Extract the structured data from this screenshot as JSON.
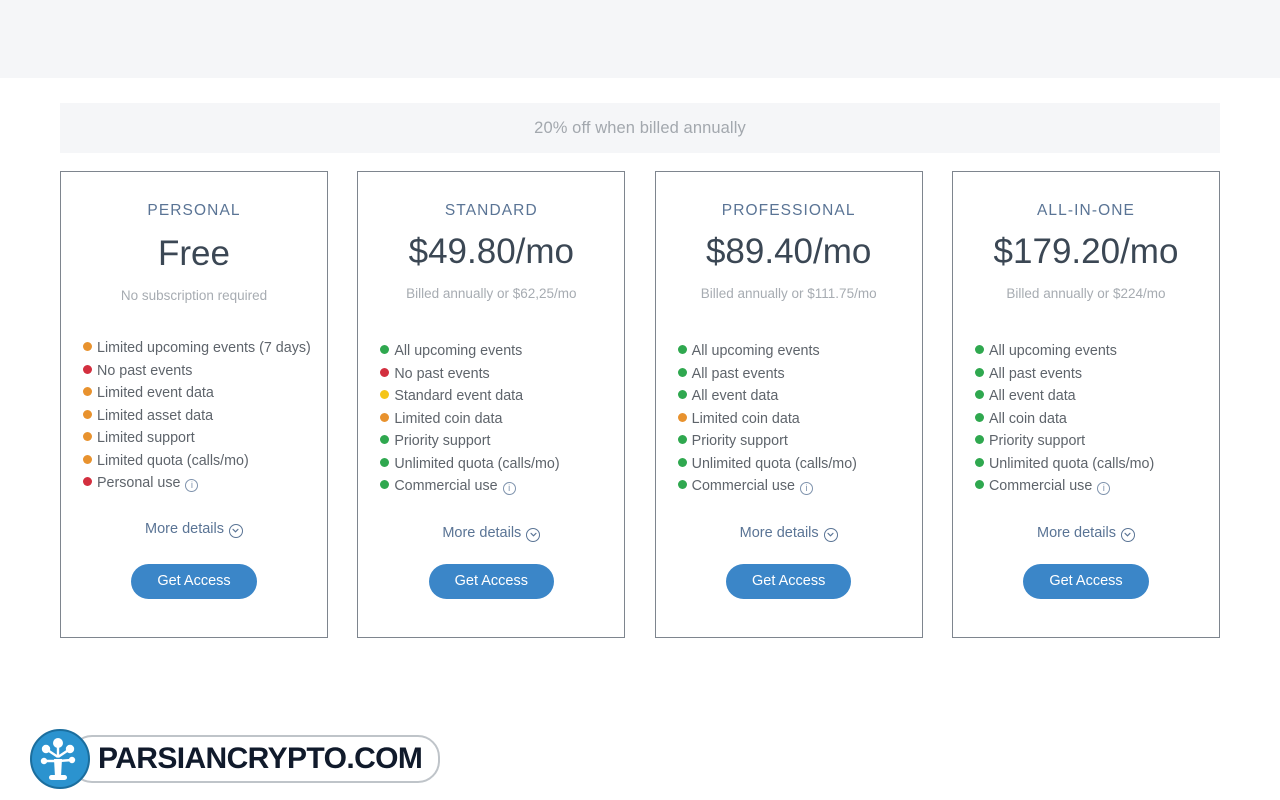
{
  "banner": {
    "text": "20% off when billed annually"
  },
  "colors": {
    "accent_blue": "#3b86c8",
    "title_blue": "#5a7495",
    "green": "#2fa84f",
    "red": "#d32f3f",
    "orange": "#e8922e",
    "yellow": "#f5c518"
  },
  "common": {
    "more_details_label": "More details",
    "cta_label": "Get Access",
    "info_glyph": "i",
    "chevron_icon": "chevron-down-icon"
  },
  "plans": [
    {
      "name": "PERSONAL",
      "price": "Free",
      "billing_note": "No subscription required",
      "features": [
        {
          "label": "Limited upcoming events (7 days)",
          "color": "#e8922e",
          "info": false
        },
        {
          "label": "No past events",
          "color": "#d32f3f",
          "info": false
        },
        {
          "label": "Limited event data",
          "color": "#e8922e",
          "info": false
        },
        {
          "label": "Limited asset data",
          "color": "#e8922e",
          "info": false
        },
        {
          "label": "Limited support",
          "color": "#e8922e",
          "info": false
        },
        {
          "label": "Limited quota (calls/mo)",
          "color": "#e8922e",
          "info": false
        },
        {
          "label": "Personal use",
          "color": "#d32f3f",
          "info": true
        }
      ]
    },
    {
      "name": "STANDARD",
      "price": "$49.80/mo",
      "billing_note": "Billed annually or $62,25/mo",
      "features": [
        {
          "label": "All upcoming events",
          "color": "#2fa84f",
          "info": false
        },
        {
          "label": "No past events",
          "color": "#d32f3f",
          "info": false
        },
        {
          "label": "Standard event data",
          "color": "#f5c518",
          "info": false
        },
        {
          "label": "Limited coin data",
          "color": "#e8922e",
          "info": false
        },
        {
          "label": "Priority support",
          "color": "#2fa84f",
          "info": false
        },
        {
          "label": "Unlimited quota (calls/mo)",
          "color": "#2fa84f",
          "info": false
        },
        {
          "label": "Commercial use",
          "color": "#2fa84f",
          "info": true
        }
      ]
    },
    {
      "name": "PROFESSIONAL",
      "price": "$89.40/mo",
      "billing_note": "Billed annually or $111.75/mo",
      "features": [
        {
          "label": "All upcoming events",
          "color": "#2fa84f",
          "info": false
        },
        {
          "label": "All past events",
          "color": "#2fa84f",
          "info": false
        },
        {
          "label": "All event data",
          "color": "#2fa84f",
          "info": false
        },
        {
          "label": "Limited coin data",
          "color": "#e8922e",
          "info": false
        },
        {
          "label": "Priority support",
          "color": "#2fa84f",
          "info": false
        },
        {
          "label": "Unlimited quota (calls/mo)",
          "color": "#2fa84f",
          "info": false
        },
        {
          "label": "Commercial use",
          "color": "#2fa84f",
          "info": true
        }
      ]
    },
    {
      "name": "ALL-IN-ONE",
      "price": "$179.20/mo",
      "billing_note": "Billed annually or $224/mo",
      "features": [
        {
          "label": "All upcoming events",
          "color": "#2fa84f",
          "info": false
        },
        {
          "label": "All past events",
          "color": "#2fa84f",
          "info": false
        },
        {
          "label": "All event data",
          "color": "#2fa84f",
          "info": false
        },
        {
          "label": "All coin data",
          "color": "#2fa84f",
          "info": false
        },
        {
          "label": "Priority support",
          "color": "#2fa84f",
          "info": false
        },
        {
          "label": "Unlimited quota (calls/mo)",
          "color": "#2fa84f",
          "info": false
        },
        {
          "label": "Commercial use",
          "color": "#2fa84f",
          "info": true
        }
      ]
    }
  ],
  "watermark": {
    "text": "PARSIANCRYPTO.COM",
    "logo_icon": "tree-network-logo-icon"
  }
}
